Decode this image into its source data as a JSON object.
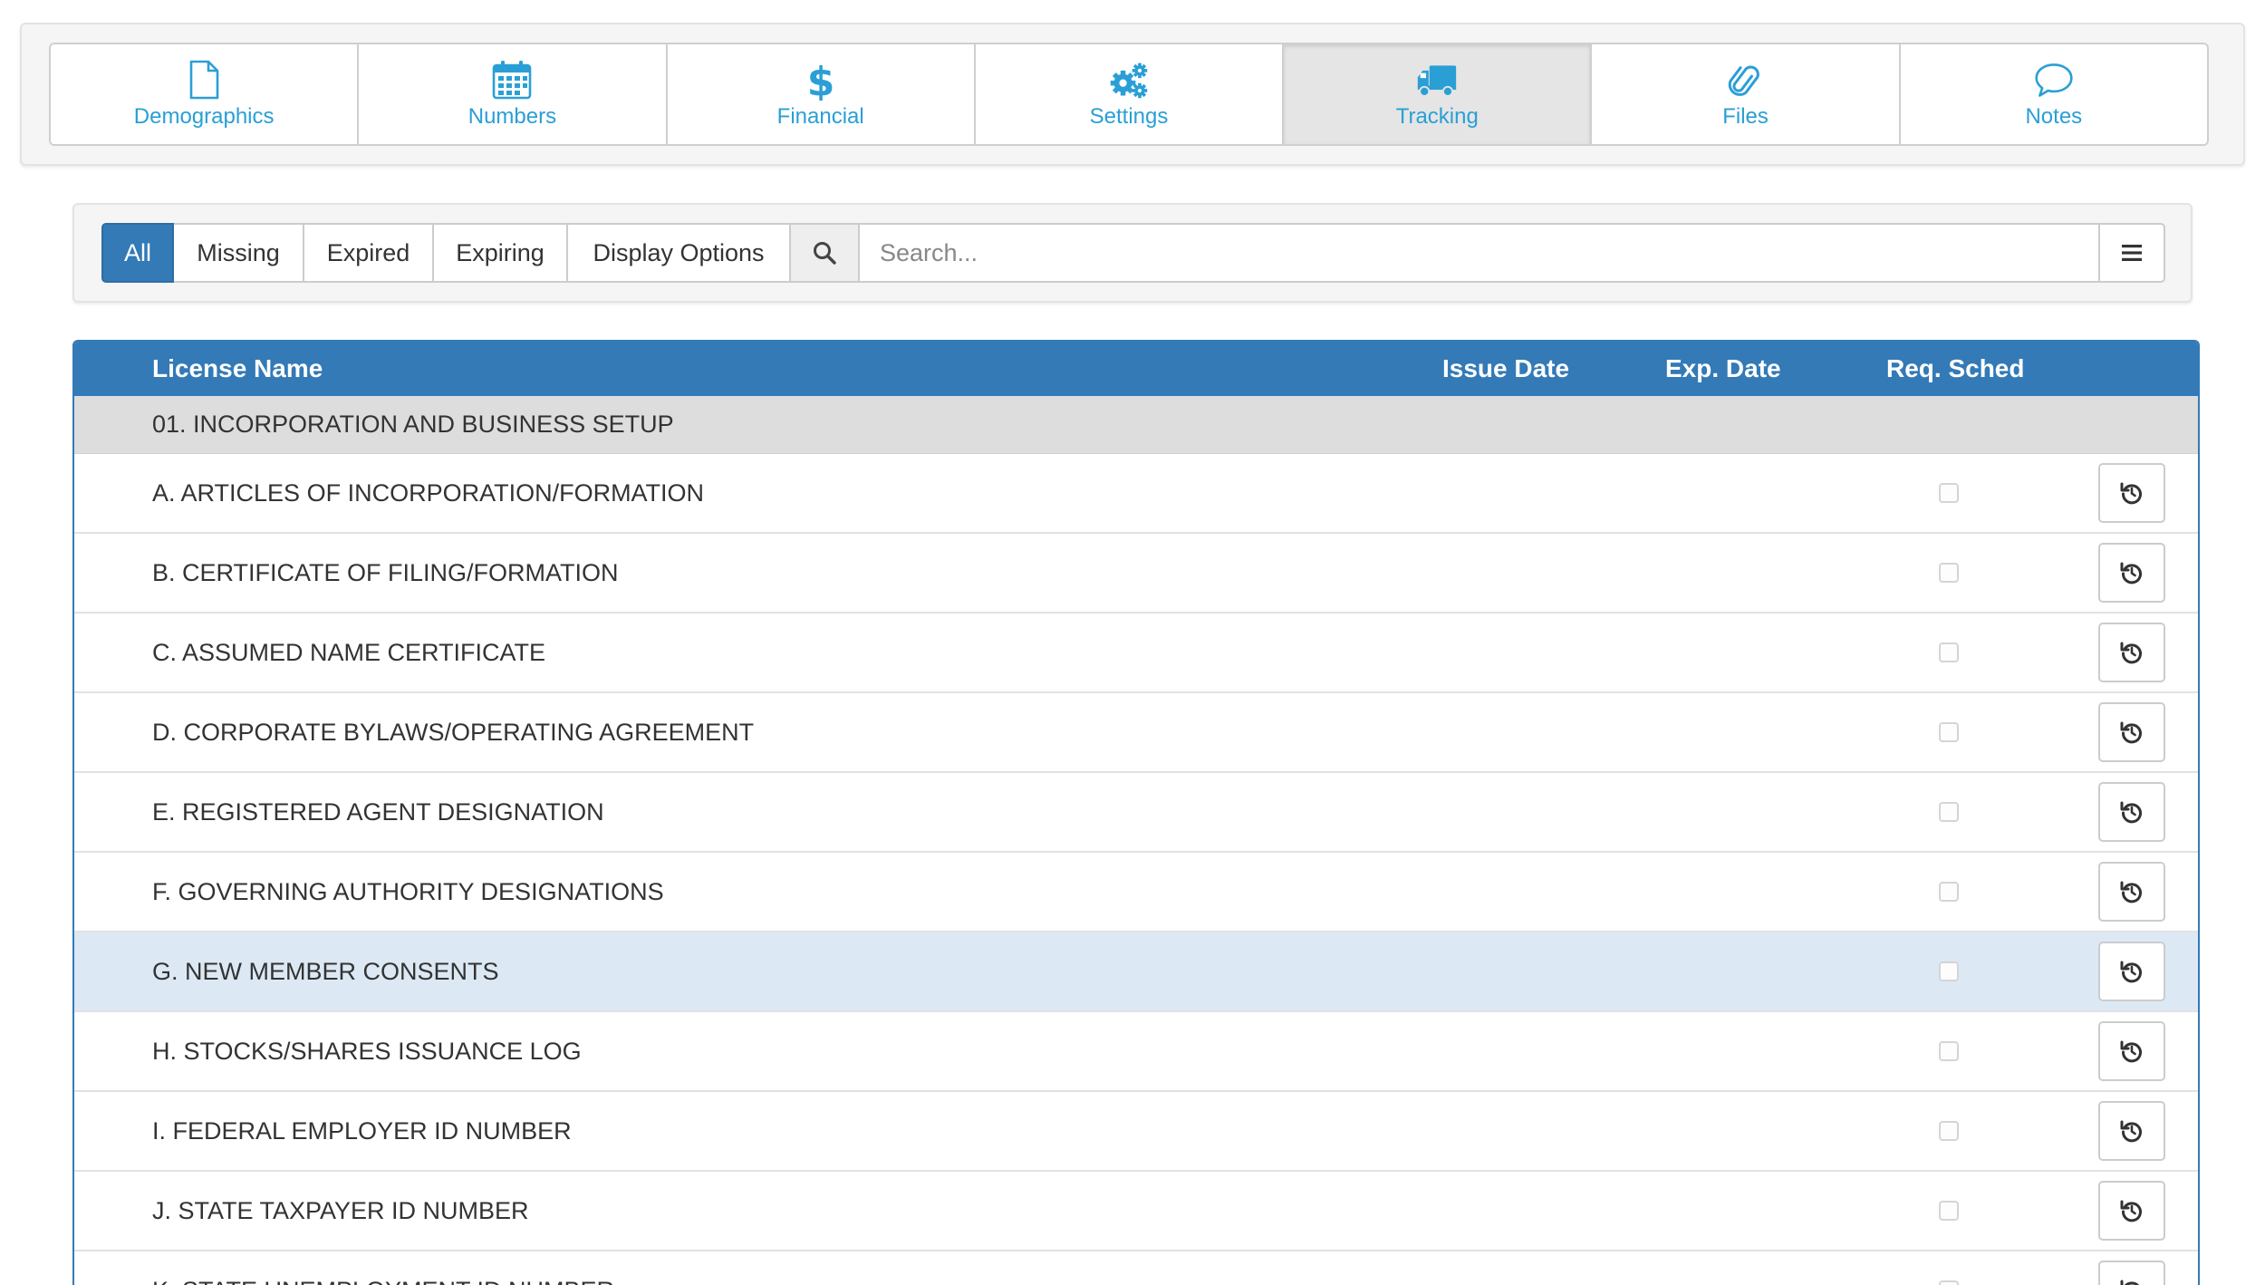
{
  "nav": {
    "tabs": [
      {
        "label": "Demographics",
        "icon": "file-icon",
        "active": false
      },
      {
        "label": "Numbers",
        "icon": "calendar-icon",
        "active": false
      },
      {
        "label": "Financial",
        "icon": "dollar-icon",
        "active": false
      },
      {
        "label": "Settings",
        "icon": "gears-icon",
        "active": false
      },
      {
        "label": "Tracking",
        "icon": "truck-icon",
        "active": true
      },
      {
        "label": "Files",
        "icon": "paperclip-icon",
        "active": false
      },
      {
        "label": "Notes",
        "icon": "speech-bubble-icon",
        "active": false
      }
    ],
    "accent": "#2a9fd6"
  },
  "filters": {
    "buttons": [
      {
        "label": "All",
        "active": true
      },
      {
        "label": "Missing",
        "active": false
      },
      {
        "label": "Expired",
        "active": false
      },
      {
        "label": "Expiring",
        "active": false
      },
      {
        "label": "Display Options",
        "active": false
      }
    ],
    "search_placeholder": "Search...",
    "search_icon": "search-icon",
    "menu_icon": "hamburger-menu-icon"
  },
  "table": {
    "header_color": "#337ab7",
    "columns": {
      "name": "License Name",
      "issue": "Issue Date",
      "exp": "Exp. Date",
      "req": "Req. Sched"
    },
    "group": "01. INCORPORATION AND BUSINESS SETUP",
    "rows": [
      {
        "label": "A. ARTICLES OF INCORPORATION/FORMATION",
        "highlight": false
      },
      {
        "label": "B. CERTIFICATE OF FILING/FORMATION",
        "highlight": false
      },
      {
        "label": "C. ASSUMED NAME CERTIFICATE",
        "highlight": false
      },
      {
        "label": "D. CORPORATE BYLAWS/OPERATING AGREEMENT",
        "highlight": false
      },
      {
        "label": "E. REGISTERED AGENT DESIGNATION",
        "highlight": false
      },
      {
        "label": "F. GOVERNING AUTHORITY DESIGNATIONS",
        "highlight": false
      },
      {
        "label": "G. NEW MEMBER CONSENTS",
        "highlight": true
      },
      {
        "label": "H. STOCKS/SHARES ISSUANCE LOG",
        "highlight": false
      },
      {
        "label": "I. FEDERAL EMPLOYER ID NUMBER",
        "highlight": false
      },
      {
        "label": "J. STATE TAXPAYER ID NUMBER",
        "highlight": false
      },
      {
        "label": "K. STATE UNEMPLOYMENT ID NUMBER",
        "highlight": false
      }
    ],
    "row_action_icon": "history-reset-icon"
  }
}
